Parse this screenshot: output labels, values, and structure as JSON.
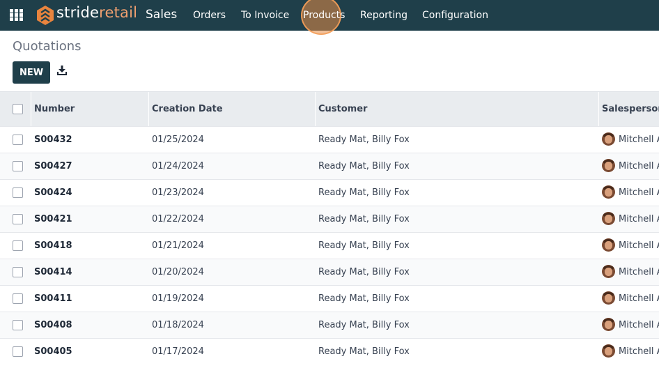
{
  "header": {
    "logo_part1": "stride",
    "logo_part2": "retail",
    "app_name": "Sales",
    "menu": [
      "Orders",
      "To Invoice",
      "Products",
      "Reporting",
      "Configuration"
    ]
  },
  "control_panel": {
    "breadcrumb": "Quotations",
    "new_button": "NEW"
  },
  "table": {
    "columns": [
      "Number",
      "Creation Date",
      "Customer",
      "Salesperson"
    ],
    "rows": [
      {
        "number": "S00432",
        "date": "01/25/2024",
        "customer": "Ready Mat, Billy Fox",
        "salesperson": "Mitchell A"
      },
      {
        "number": "S00427",
        "date": "01/24/2024",
        "customer": "Ready Mat, Billy Fox",
        "salesperson": "Mitchell A"
      },
      {
        "number": "S00424",
        "date": "01/23/2024",
        "customer": "Ready Mat, Billy Fox",
        "salesperson": "Mitchell A"
      },
      {
        "number": "S00421",
        "date": "01/22/2024",
        "customer": "Ready Mat, Billy Fox",
        "salesperson": "Mitchell A"
      },
      {
        "number": "S00418",
        "date": "01/21/2024",
        "customer": "Ready Mat, Billy Fox",
        "salesperson": "Mitchell A"
      },
      {
        "number": "S00414",
        "date": "01/20/2024",
        "customer": "Ready Mat, Billy Fox",
        "salesperson": "Mitchell A"
      },
      {
        "number": "S00411",
        "date": "01/19/2024",
        "customer": "Ready Mat, Billy Fox",
        "salesperson": "Mitchell A"
      },
      {
        "number": "S00408",
        "date": "01/18/2024",
        "customer": "Ready Mat, Billy Fox",
        "salesperson": "Mitchell A"
      },
      {
        "number": "S00405",
        "date": "01/17/2024",
        "customer": "Ready Mat, Billy Fox",
        "salesperson": "Mitchell A"
      }
    ]
  },
  "colors": {
    "topbar": "#1f3f4a",
    "accent": "#f0a070",
    "highlight": "#e68c46"
  }
}
